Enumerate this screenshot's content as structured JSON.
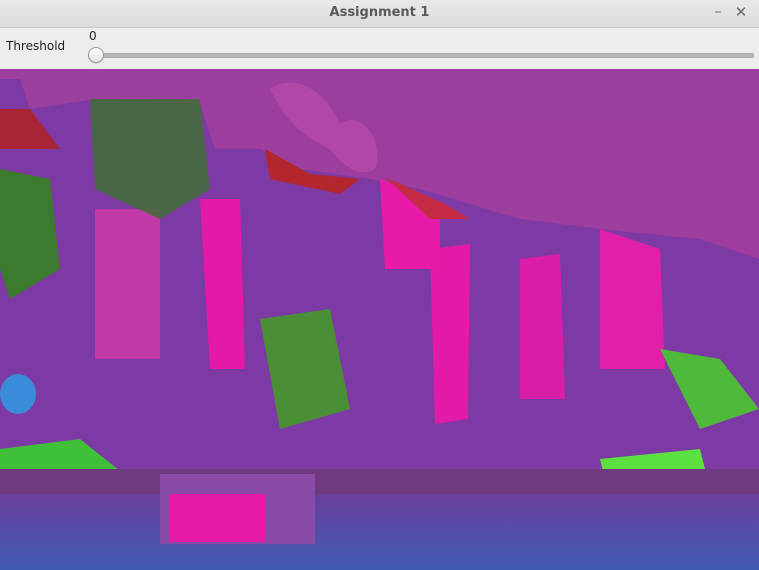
{
  "window": {
    "title": "Assignment 1",
    "minimize_glyph": "–",
    "close_glyph": "✕"
  },
  "controls": {
    "threshold_label": "Threshold",
    "threshold_value": "0",
    "threshold_fraction": 0.0
  },
  "image": {
    "description_colors": {
      "sky": "#9a3fa0",
      "magenta": "#e61aa8",
      "green": "#52d93c",
      "red": "#b3262e",
      "purple": "#7a3fb5",
      "water": "#5c4aa8"
    }
  }
}
